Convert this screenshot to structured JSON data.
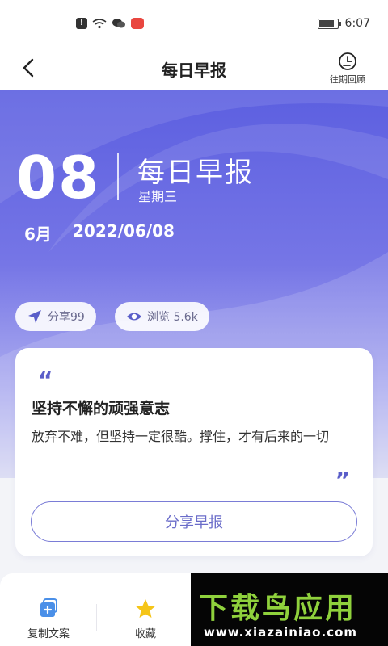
{
  "status": {
    "time": "6:07",
    "battery_level": 0.85
  },
  "nav": {
    "title": "每日早报",
    "history_label": "往期回顾"
  },
  "hero": {
    "day": "08",
    "report_title": "每日早报",
    "weekday": "星期三",
    "month": "6月",
    "date": "2022/06/08",
    "share_label": "分享99",
    "views_label": "浏览 5.6k"
  },
  "quote": {
    "open_mark": "“",
    "title": "坚持不懈的顽强意志",
    "text": "放弃不难，但坚持一定很酷。撑住，才有后来的一切",
    "close_mark": "”",
    "share_button": "分享早报"
  },
  "toolbar": {
    "copy_label": "复制文案",
    "favorite_label": "收藏"
  },
  "watermark": {
    "title": "下载鸟应用",
    "url": "www.xiazainiao.com"
  },
  "colors": {
    "accent": "#6a6cc9",
    "hero_top": "#5c5fe0",
    "star": "#f5c518",
    "copy_icon": "#4a8fe8",
    "watermark_green": "#8fd13c"
  }
}
